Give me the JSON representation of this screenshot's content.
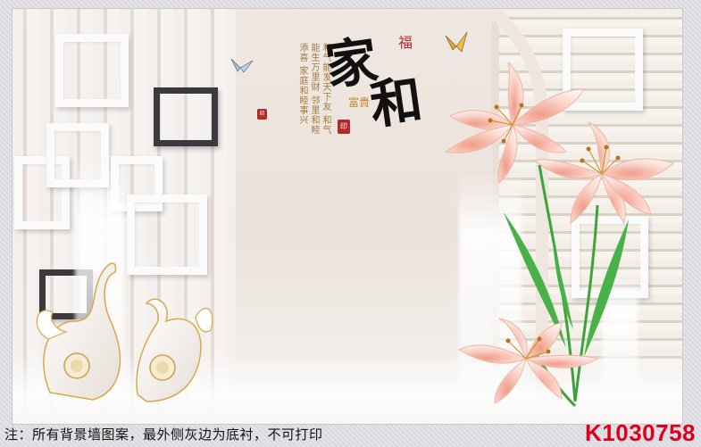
{
  "artwork": {
    "headline_char_1": "家",
    "headline_char_2": "和",
    "fu_char": "福",
    "fugui_text": "富貴",
    "poem_text": "和气能发天下友 和气能生万里财 邻里和睦添喜 家庭和睦事兴",
    "seal_text": "印"
  },
  "footer": {
    "note": "注：所有背景墙图案，最外侧灰边为底衬，不可打印",
    "product_code": "K1030758"
  },
  "colors": {
    "code_red": "#e0001b",
    "lily_pink": "#f3b5a8",
    "stem_green": "#3da23a",
    "gold": "#d8a84a"
  }
}
